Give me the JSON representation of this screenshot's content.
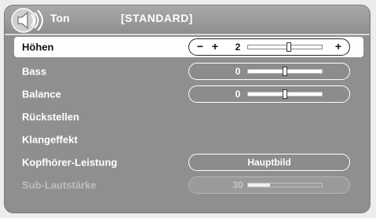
{
  "header": {
    "title": "Ton",
    "preset": "[STANDARD]",
    "icon": "speaker-icon"
  },
  "rows": [
    {
      "label": "Höhen",
      "value": "2",
      "minus": "−",
      "plus_inline": "+",
      "plus": "+",
      "level": 0.55
    },
    {
      "label": "Bass",
      "value": "0",
      "level": 0.5
    },
    {
      "label": "Balance",
      "value": "0",
      "level": 0.5
    },
    {
      "label": "Rückstellen"
    },
    {
      "label": "Klangeffekt"
    },
    {
      "label": "Kopfhörer-Leistung",
      "value": "Hauptbild"
    },
    {
      "label": "Sub-Lautstärke",
      "value": "30",
      "level": 0.3
    }
  ],
  "colors": {
    "panel": "#8f8f8f",
    "selected": "#ffffff",
    "text": "#ffffff",
    "disabled_text": "#bdbdbd"
  }
}
